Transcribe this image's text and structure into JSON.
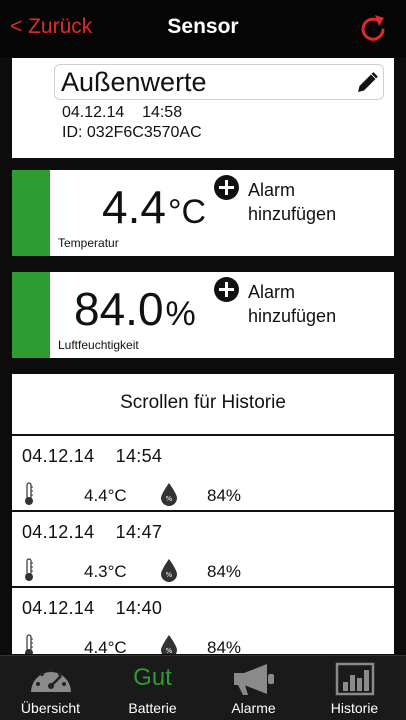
{
  "navbar": {
    "back_label": "< Zurück",
    "title": "Sensor"
  },
  "sensor": {
    "name": "Außenwerte",
    "date": "04.12.14",
    "time": "14:58",
    "id": "ID: 032F6C3570AC"
  },
  "temperature": {
    "value": "4.4",
    "unit": "°C",
    "alarm_label": "Alarm hinzufügen",
    "caption": "Temperatur"
  },
  "humidity": {
    "value": "84.0",
    "unit": "%",
    "alarm_label": "Alarm hinzufügen",
    "caption": "Luftfeuchtigkeit"
  },
  "history": {
    "title": "Scrollen für Historie",
    "entries": [
      {
        "datetime": "04.12.14    14:54",
        "temp": "4.4°C",
        "hum": "84%"
      },
      {
        "datetime": "04.12.14    14:47",
        "temp": "4.3°C",
        "hum": "84%"
      },
      {
        "datetime": "04.12.14    14:40",
        "temp": "4.4°C",
        "hum": "84%"
      }
    ]
  },
  "tabs": {
    "overview": "Übersicht",
    "battery_status": "Gut",
    "battery": "Batterie",
    "alarms": "Alarme",
    "history": "Historie"
  },
  "colors": {
    "accent_red": "#e02a2a",
    "status_green": "#2e9b33",
    "background": "#0c0c0c"
  },
  "icons": [
    "refresh-icon",
    "pencil-icon",
    "plus-icon",
    "thermometer-icon",
    "drop-icon",
    "gauge-icon",
    "megaphone-icon",
    "bar-chart-icon"
  ]
}
